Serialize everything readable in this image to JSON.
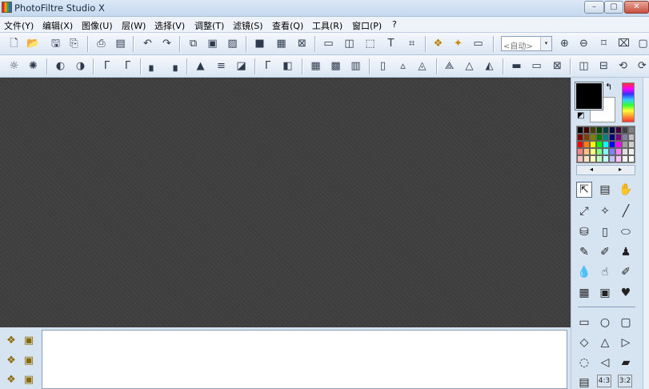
{
  "window": {
    "title": "PhotoFiltre Studio X",
    "min_glyph": "–",
    "max_glyph": "▢",
    "close_glyph": "✕"
  },
  "menu": [
    "文件(Y)",
    "编辑(X)",
    "图像(U)",
    "层(W)",
    "选择(V)",
    "调整(T)",
    "滤镜(S)",
    "查看(Q)",
    "工具(R)",
    "窗口(P)",
    "?"
  ],
  "toolbar": {
    "zoom_value": "<自动>",
    "zoom_arrow": "▾"
  },
  "palette": {
    "colors": [
      "#000000",
      "#400000",
      "#404000",
      "#004000",
      "#004040",
      "#000040",
      "#400040",
      "#404040",
      "#808080",
      "#800000",
      "#804000",
      "#808000",
      "#008000",
      "#008080",
      "#000080",
      "#800080",
      "#8080a0",
      "#c0c0c0",
      "#ff0000",
      "#ff8000",
      "#ffff00",
      "#00ff00",
      "#00ffff",
      "#0000ff",
      "#ff00ff",
      "#a0a0a0",
      "#d0d0d0",
      "#ff8080",
      "#ffc080",
      "#ffff80",
      "#80ff80",
      "#80ffff",
      "#8080ff",
      "#ff80ff",
      "#e0e0e0",
      "#f0f0f0",
      "#ffc0c0",
      "#ffe0c0",
      "#ffffc0",
      "#c0ffc0",
      "#c0ffff",
      "#c0c0ff",
      "#ffc0ff",
      "#f4f4f4",
      "#ffffff"
    ],
    "prev_glyph": "◂",
    "next_glyph": "▸",
    "swap_glyph": "↰",
    "reset_glyph": "◩"
  },
  "toolpanel": {
    "ratio_43": "4:3",
    "ratio_32": "3:2"
  }
}
